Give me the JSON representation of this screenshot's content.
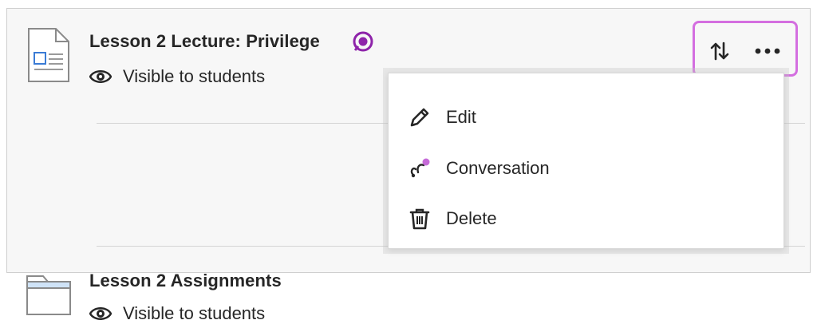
{
  "items": [
    {
      "title": "Lesson 2 Lecture: Privilege",
      "visibility": "Visible to students",
      "type_icon": "document-icon",
      "has_conversation_badge": true
    },
    {
      "title": "Lesson 2 Assignments",
      "visibility": "Visible to students",
      "type_icon": "folder-icon"
    }
  ],
  "actions": {
    "reorder_icon": "reorder-arrows-icon",
    "more_icon": "more-options-icon"
  },
  "menu": {
    "items": [
      {
        "label": "Edit",
        "icon": "pencil-icon"
      },
      {
        "label": "Conversation",
        "icon": "conversation-icon"
      },
      {
        "label": "Delete",
        "icon": "trash-icon"
      }
    ]
  },
  "colors": {
    "highlight": "#d46ee0",
    "badge": "#8e24aa",
    "text": "#262626",
    "panel_bg": "#f7f7f7"
  }
}
